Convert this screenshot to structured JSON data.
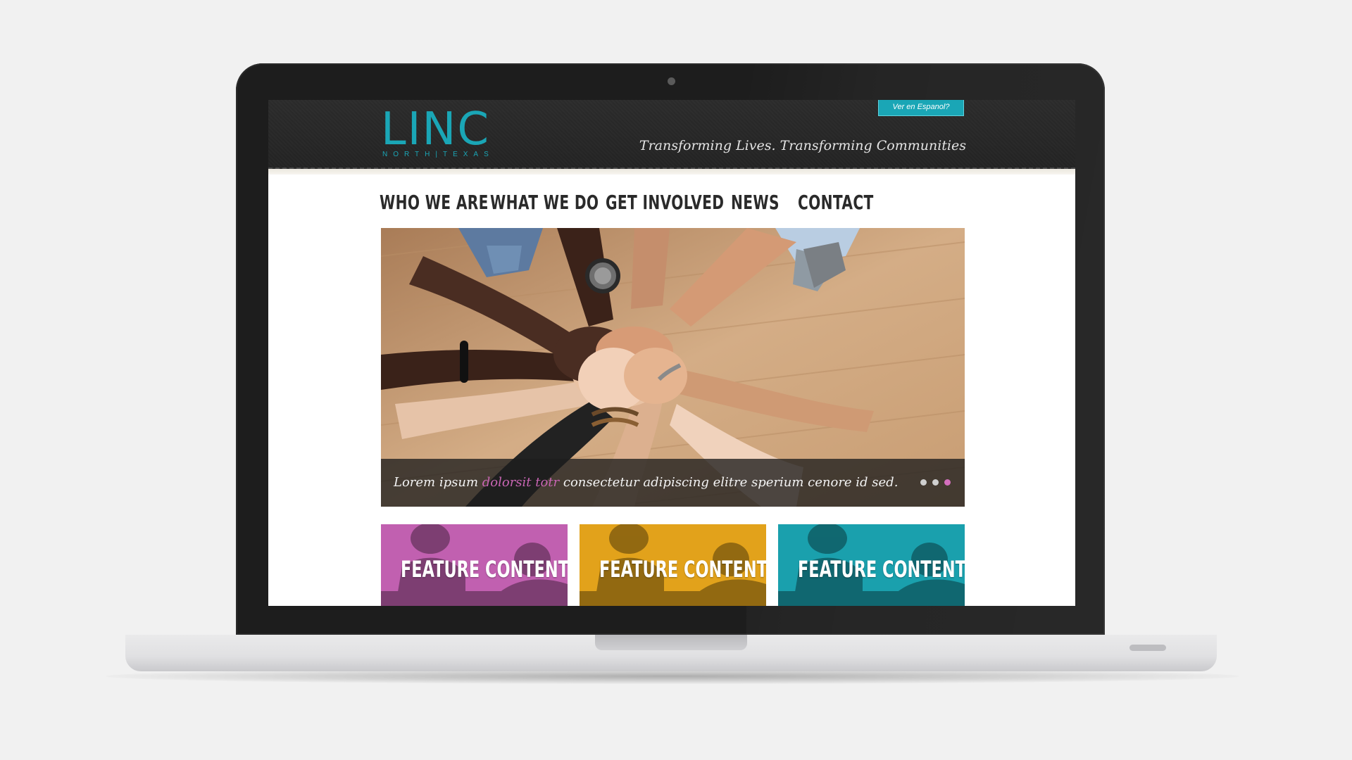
{
  "site": {
    "logo_text": "LINC",
    "logo_subtext": "NORTH|TEXAS",
    "language_button": "Ver en Espanol?",
    "tagline": "Transforming Lives. Transforming Communities"
  },
  "nav": {
    "items": [
      {
        "label": "WHO WE ARE"
      },
      {
        "label": "WHAT WE DO"
      },
      {
        "label": "GET INVOLVED"
      },
      {
        "label": "NEWS"
      },
      {
        "label": "CONTACT"
      }
    ]
  },
  "hero": {
    "caption_part1": "Lorem ipsum ",
    "caption_highlight": "dolorsit totr",
    "caption_part2": " consectetur adipiscing elitre sperium cenore id sed.",
    "slide_count": 3,
    "active_slide": 3
  },
  "features": [
    {
      "label": "FEATURE CONTENT",
      "color": "#c160b0"
    },
    {
      "label": "FEATURE CONTENT",
      "color": "#e2a21b"
    },
    {
      "label": "FEATURE CONTENT",
      "color": "#1aa0ad"
    }
  ],
  "colors": {
    "brand_teal": "#1aa6b6",
    "accent_magenta": "#c865b3",
    "header_dark": "#262626",
    "laptop_bezel": "#1d1d1d",
    "dot_active": "#d46fbe",
    "dot_inactive": "#cfcfcf"
  }
}
